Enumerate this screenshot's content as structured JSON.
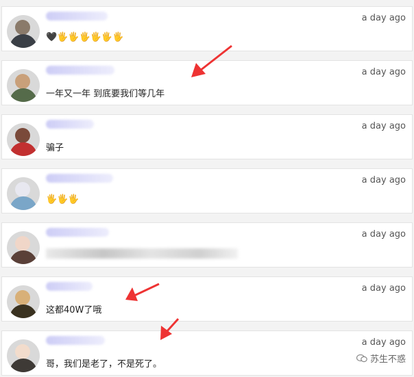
{
  "comments": [
    {
      "time": "a day ago",
      "message": "🖤🖐🖐🖐🖐🖐🖐",
      "avatar_colors": [
        "#8a7a6a",
        "#3a3f46"
      ]
    },
    {
      "time": "a day ago",
      "message": "一年又一年 到底要我们等几年",
      "avatar_colors": [
        "#c9a07a",
        "#556b4a"
      ]
    },
    {
      "time": "a day ago",
      "message": "骗子",
      "avatar_colors": [
        "#7a4a3a",
        "#c23030"
      ]
    },
    {
      "time": "a day ago",
      "message": "🖐🖐🖐",
      "avatar_colors": [
        "#e8e8f0",
        "#7aa6c8"
      ]
    },
    {
      "time": "a day ago",
      "message": "",
      "avatar_colors": [
        "#f0d6c8",
        "#5a4038"
      ]
    },
    {
      "time": "a day ago",
      "message": "这都40W了哦",
      "avatar_colors": [
        "#d8b078",
        "#3a3220"
      ]
    },
    {
      "time": "a day ago",
      "message": "哥，我们是老了，不是死了。",
      "avatar_colors": [
        "#f2dccc",
        "#3e3a36"
      ]
    }
  ],
  "watermark": {
    "text": "苏生不惑",
    "icon": "wechat-icon"
  },
  "colors": {
    "arrow": "#ee3333",
    "card": "#ffffff",
    "time": "#555555"
  }
}
